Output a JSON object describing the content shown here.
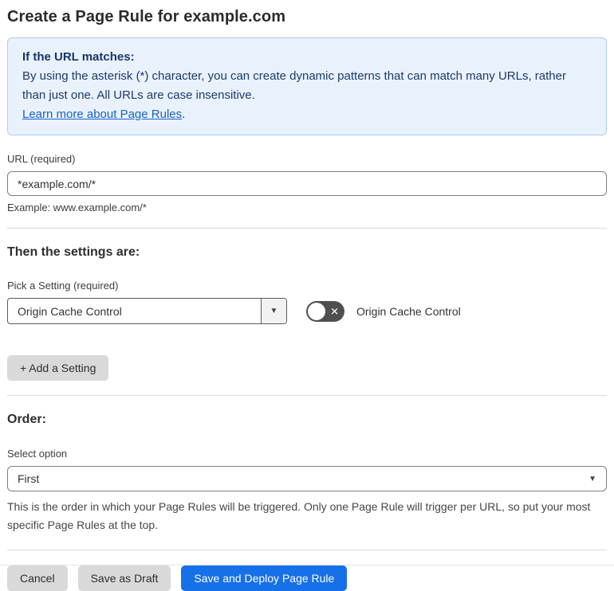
{
  "page": {
    "title": "Create a Page Rule for example.com"
  },
  "info_box": {
    "heading": "If the URL matches:",
    "body": "By using the asterisk (*) character, you can create dynamic patterns that can match many URLs, rather than just one. All URLs are case insensitive.",
    "link": "Learn more about Page Rules",
    "link_suffix": "."
  },
  "url_section": {
    "label": "URL (required)",
    "value": "*example.com/*",
    "helper": "Example: www.example.com/*"
  },
  "settings_section": {
    "heading": "Then the settings are:",
    "pick_label": "Pick a Setting (required)",
    "selected_setting": "Origin Cache Control",
    "toggle_label": "Origin Cache Control",
    "toggle_state": "off",
    "add_button": "+ Add a Setting"
  },
  "order_section": {
    "heading": "Order:",
    "label": "Select option",
    "selected_option": "First",
    "helper": "This is the order in which your Page Rules will be triggered. Only one Page Rule will trigger per URL, so put your most specific Page Rules at the top."
  },
  "footer": {
    "cancel": "Cancel",
    "save_draft": "Save as Draft",
    "save_deploy": "Save and Deploy Page Rule"
  },
  "icons": {
    "dropdown_arrow": "▼",
    "toggle_x": "✕"
  },
  "colors": {
    "accent_blue": "#1670e8",
    "info_bg": "#e9f2fc",
    "info_border": "#abcdee",
    "info_text": "#1c3a6b",
    "link_blue": "#1862c6",
    "toggle_off_bg": "#4f4f4f",
    "button_gray": "#d9d9d9"
  }
}
